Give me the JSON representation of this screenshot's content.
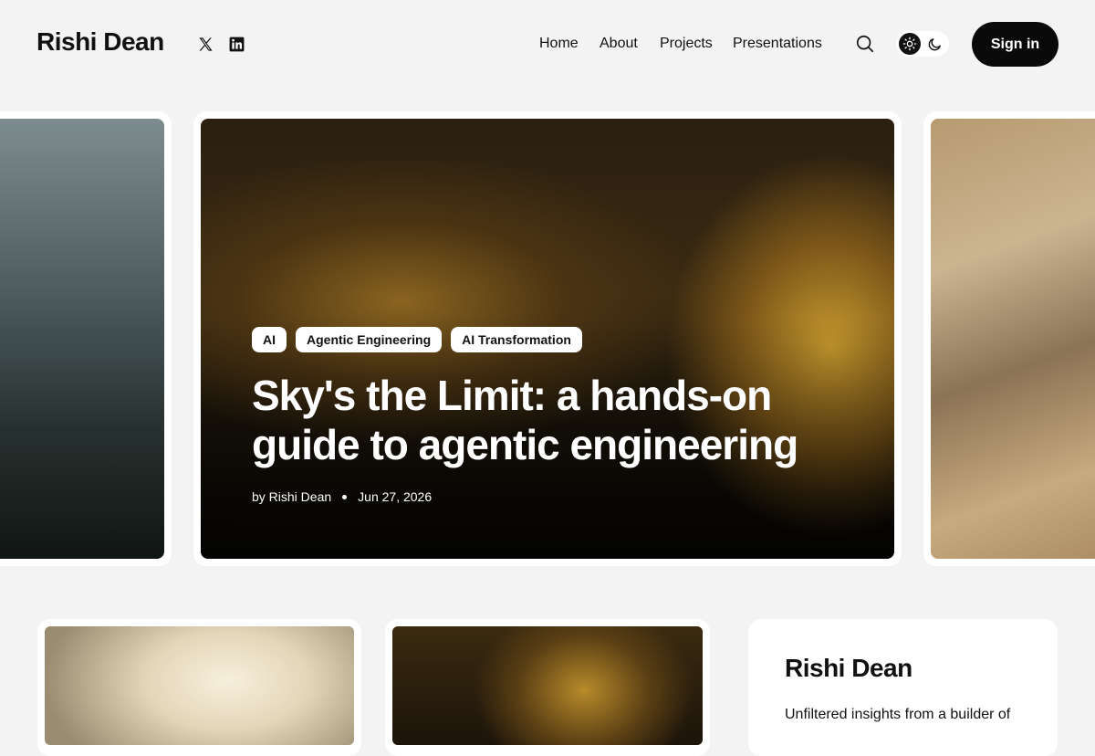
{
  "header": {
    "site_title": "Rishi Dean",
    "social": [
      {
        "icon": "x-logo-icon"
      },
      {
        "icon": "linkedin-icon"
      }
    ],
    "nav": [
      "Home",
      "About",
      "Projects",
      "Presentations"
    ],
    "search_icon": "search-icon",
    "theme_toggle": {
      "light_icon": "sun-icon",
      "dark_icon": "moon-icon",
      "active": "light"
    },
    "signin_label": "Sign in"
  },
  "featured": {
    "tags": [
      "AI",
      "Agentic Engineering",
      "AI Transformation"
    ],
    "title": "Sky's the Limit: a hands-on guide to agentic engineering",
    "author": "by Rishi Dean",
    "date": "Jun 27, 2026"
  },
  "sidebar": {
    "title": "Rishi Dean",
    "description": "Unfiltered insights from a builder of"
  },
  "colors": {
    "accent": "#0a0a0a",
    "background": "#f3f3f3",
    "card": "#ffffff"
  }
}
